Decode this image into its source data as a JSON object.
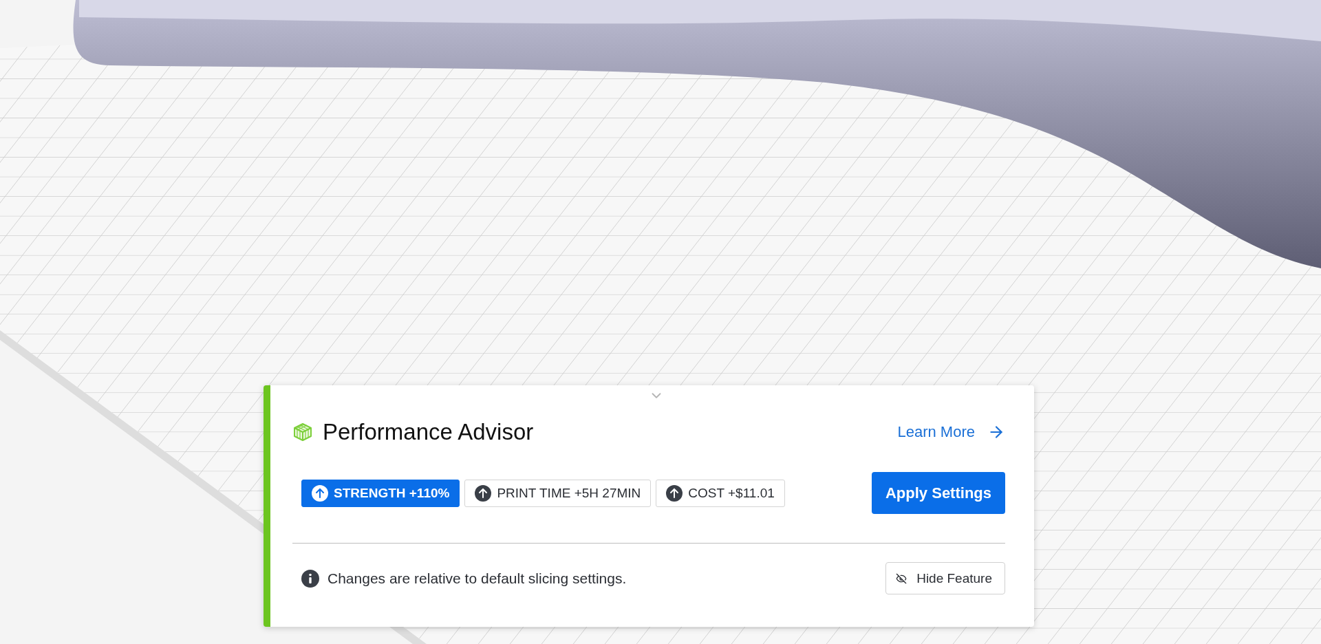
{
  "advisor": {
    "title": "Performance Advisor",
    "link": "Learn More",
    "chips": [
      {
        "label": "STRENGTH +110%",
        "selected": true
      },
      {
        "label": "PRINT TIME +5H 27MIN",
        "selected": false
      },
      {
        "label": "COST +$11.01",
        "selected": false
      }
    ],
    "apply_button": "Apply Settings",
    "note": "Changes are relative to default slicing settings.",
    "hide_button": "Hide Feature"
  }
}
